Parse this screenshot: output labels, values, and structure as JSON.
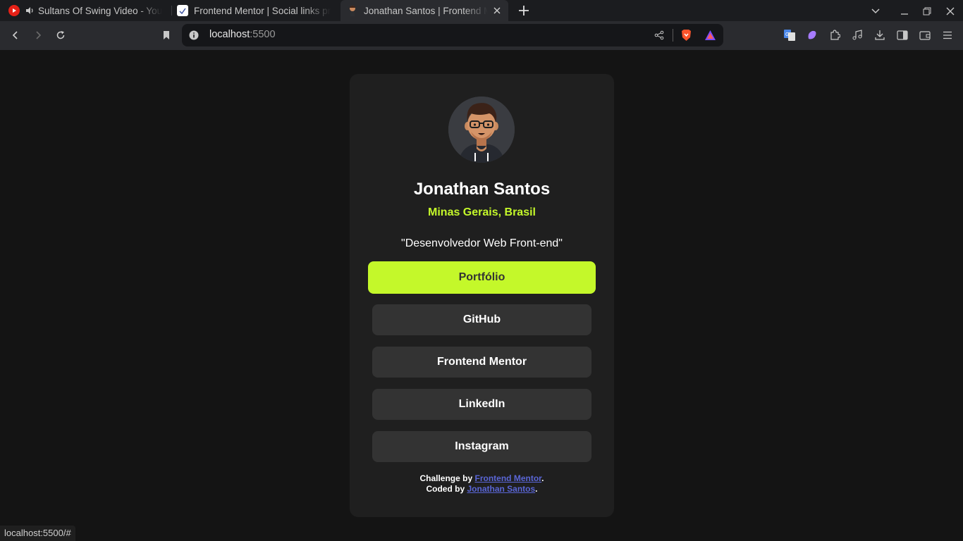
{
  "browser": {
    "tabs": [
      {
        "title": "Sultans Of Swing Video - You",
        "icon": "youtube-icon",
        "audio": true
      },
      {
        "title": "Frontend Mentor | Social links pr",
        "icon": "frontend-mentor-icon"
      },
      {
        "title": "Jonathan Santos | Frontend M",
        "icon": "avatar-favicon",
        "active": true
      }
    ],
    "new_tab_icon": "plus-icon",
    "url": {
      "host": "localhost",
      "port": ":5500"
    },
    "status_url": "localhost:5500/#"
  },
  "profile": {
    "name": "Jonathan Santos",
    "location": "Minas Gerais, Brasil",
    "bio": "\"Desenvolvedor Web Front-end\""
  },
  "links": [
    {
      "label": "Portfólio",
      "active": true
    },
    {
      "label": "GitHub"
    },
    {
      "label": "Frontend Mentor"
    },
    {
      "label": "LinkedIn"
    },
    {
      "label": "Instagram"
    }
  ],
  "footer": {
    "challenge_prefix": "Challenge by ",
    "challenge_link": "Frontend Mentor",
    "coded_prefix": "Coded by ",
    "coded_link": "Jonathan Santos",
    "period": "."
  },
  "colors": {
    "accent": "#c4f82a",
    "card": "#1f1f1f",
    "button": "#333333",
    "page_bg": "#141414",
    "footer_link": "#5a66d6"
  }
}
